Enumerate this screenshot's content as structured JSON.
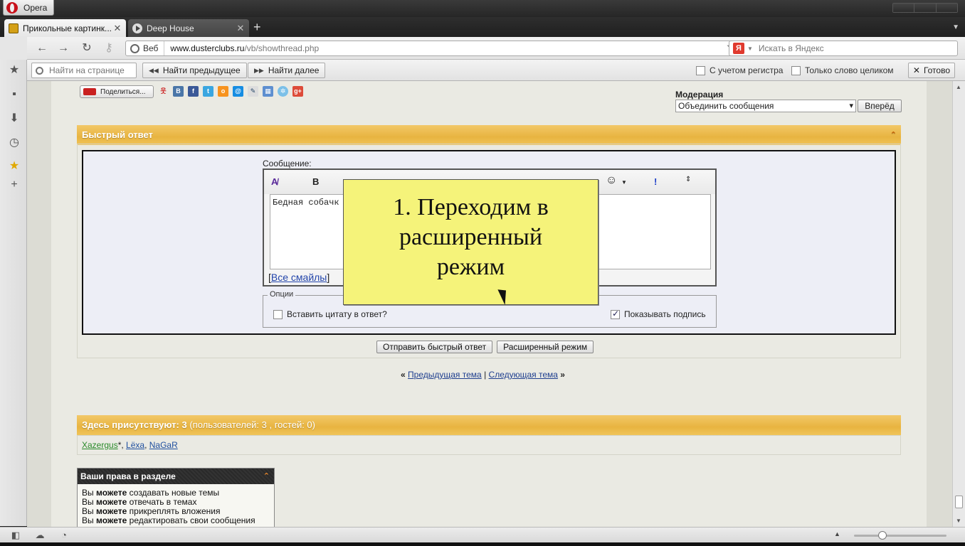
{
  "window": {
    "app_name": "Opera"
  },
  "tabs": [
    {
      "title": "Прикольные картинк...",
      "active": true
    },
    {
      "title": "Deep House",
      "active": false
    }
  ],
  "address": {
    "web_label": "Веб",
    "url_host": "www.dusterclubs.ru",
    "url_path": "/vb/showthread.php",
    "search_placeholder": "Искать в Яндекс"
  },
  "findbar": {
    "placeholder": "Найти на странице",
    "prev_label": "Найти предыдущее",
    "next_label": "Найти далее",
    "match_case_label": "С учетом регистра",
    "whole_word_label": "Только слово целиком",
    "done_label": "Готово"
  },
  "share": {
    "label": "Поделиться..."
  },
  "moderation": {
    "label": "Модерация",
    "selected": "Объединить сообщения",
    "go_label": "Вперёд"
  },
  "quick_reply": {
    "title": "Быстрый ответ",
    "message_label": "Сообщение:",
    "message_text": "Бедная собачк",
    "all_smiles_label": "Все смайлы",
    "options_legend": "Опции",
    "quote_label": "Вставить цитату в ответ?",
    "signature_label": "Показывать подпись",
    "signature_checked": true,
    "send_label": "Отправить быстрый ответ",
    "advanced_label": "Расширенный режим"
  },
  "thread_nav": {
    "prev_label": "Предыдущая тема",
    "separator": "|",
    "next_label": "Следующая тема"
  },
  "online": {
    "title_bold": "Здесь присутствуют: 3",
    "title_rest": "(пользователей: 3 , гостей: 0)",
    "users": [
      "Xazergus",
      "Lёxa",
      "NaGaR"
    ]
  },
  "rights": {
    "title": "Ваши права в разделе",
    "items": [
      {
        "prefix": "Вы",
        "bold": "можете",
        "rest": "создавать новые темы"
      },
      {
        "prefix": "Вы",
        "bold": "можете",
        "rest": "отвечать в темах"
      },
      {
        "prefix": "Вы",
        "bold": "можете",
        "rest": "прикреплять вложения"
      },
      {
        "prefix": "Вы",
        "bold": "можете",
        "rest": "редактировать свои сообщения"
      }
    ]
  },
  "annotation": {
    "line1": "1. Переходим в",
    "line2": "расширенный",
    "line3": "режим"
  }
}
